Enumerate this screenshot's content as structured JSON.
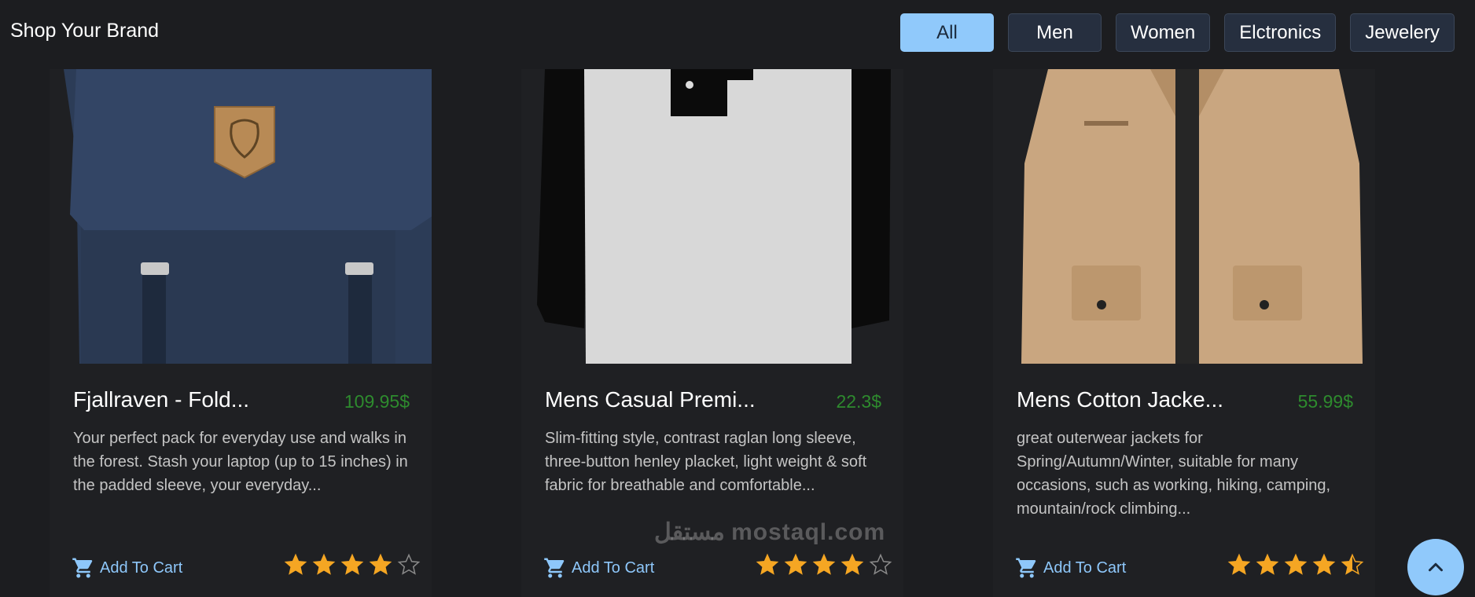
{
  "header": {
    "brand": "Shop Your Brand",
    "filters": [
      {
        "label": "All",
        "active": true
      },
      {
        "label": "Men",
        "active": false
      },
      {
        "label": "Women",
        "active": false
      },
      {
        "label": "Elctronics",
        "active": false
      },
      {
        "label": "Jewelery",
        "active": false
      }
    ]
  },
  "products": [
    {
      "title": "Fjallraven - Fold...",
      "price": "109.95$",
      "description": "Your perfect pack for everyday use and walks in the forest. Stash your laptop (up to 15 inches) in the padded sleeve, your everyday...",
      "cart_label": "Add To Cart",
      "rating": 4,
      "image_icon": "backpack-image"
    },
    {
      "title": "Mens Casual Premi...",
      "price": "22.3$",
      "description": "Slim-fitting style, contrast raglan long sleeve, three-button henley placket, light weight & soft fabric for breathable and comfortable...",
      "cart_label": "Add To Cart",
      "rating": 4,
      "image_icon": "tshirt-image"
    },
    {
      "title": "Mens Cotton Jacke...",
      "price": "55.99$",
      "description": "great outerwear jackets for Spring/Autumn/Winter, suitable for many occasions, such as working, hiking, camping, mountain/rock climbing...",
      "cart_label": "Add To Cart",
      "rating": 4.5,
      "image_icon": "jacket-image"
    }
  ],
  "watermark": "مستقل mostaql.com",
  "colors": {
    "background": "#1c1d20",
    "accent": "#90c9fb",
    "price": "#2e8b2e",
    "star": "#f5a623"
  }
}
